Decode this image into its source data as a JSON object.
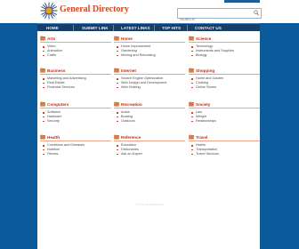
{
  "brand": {
    "name": "General Directory"
  },
  "search": {
    "placeholder": "SEARCH"
  },
  "nav": {
    "items": [
      "Home",
      "Submit Link",
      "Latest Links",
      "Top Hits",
      "Contact Us"
    ]
  },
  "categories": [
    {
      "title": "Arts",
      "items": [
        "Video",
        "Animation",
        "Crafts"
      ]
    },
    {
      "title": "Home",
      "items": [
        "Home Improvement",
        "Gardening",
        "Moving and Relocating"
      ]
    },
    {
      "title": "Science",
      "items": [
        "Technology",
        "Instruments and Supplies",
        "Biology"
      ]
    },
    {
      "title": "Business",
      "items": [
        "Marketing and Advertising",
        "Real Estate",
        "Financial Services"
      ]
    },
    {
      "title": "Internet",
      "items": [
        "Search Engine Optimization",
        "Web Design and Development",
        "Web Hosting"
      ]
    },
    {
      "title": "Shopping",
      "items": [
        "Home and Garden",
        "Clothing",
        "Online Stores"
      ]
    },
    {
      "title": "Computers",
      "items": [
        "Software",
        "Hardware",
        "Security"
      ]
    },
    {
      "title": "Recreation",
      "items": [
        "Autos",
        "Boating",
        "Outdoors"
      ]
    },
    {
      "title": "Society",
      "items": [
        "Law",
        "Weight",
        "Relationships"
      ]
    },
    {
      "title": "Health",
      "items": [
        "Conditions and Diseases",
        "Nutrition",
        "Fitness"
      ]
    },
    {
      "title": "Reference",
      "items": [
        "Education",
        "Dictionaries",
        "Ask an Expert"
      ]
    },
    {
      "title": "Travel",
      "items": [
        "Hotels",
        "Transportation",
        "Travel Services"
      ]
    }
  ],
  "footer": {
    "text": "General Directory"
  }
}
